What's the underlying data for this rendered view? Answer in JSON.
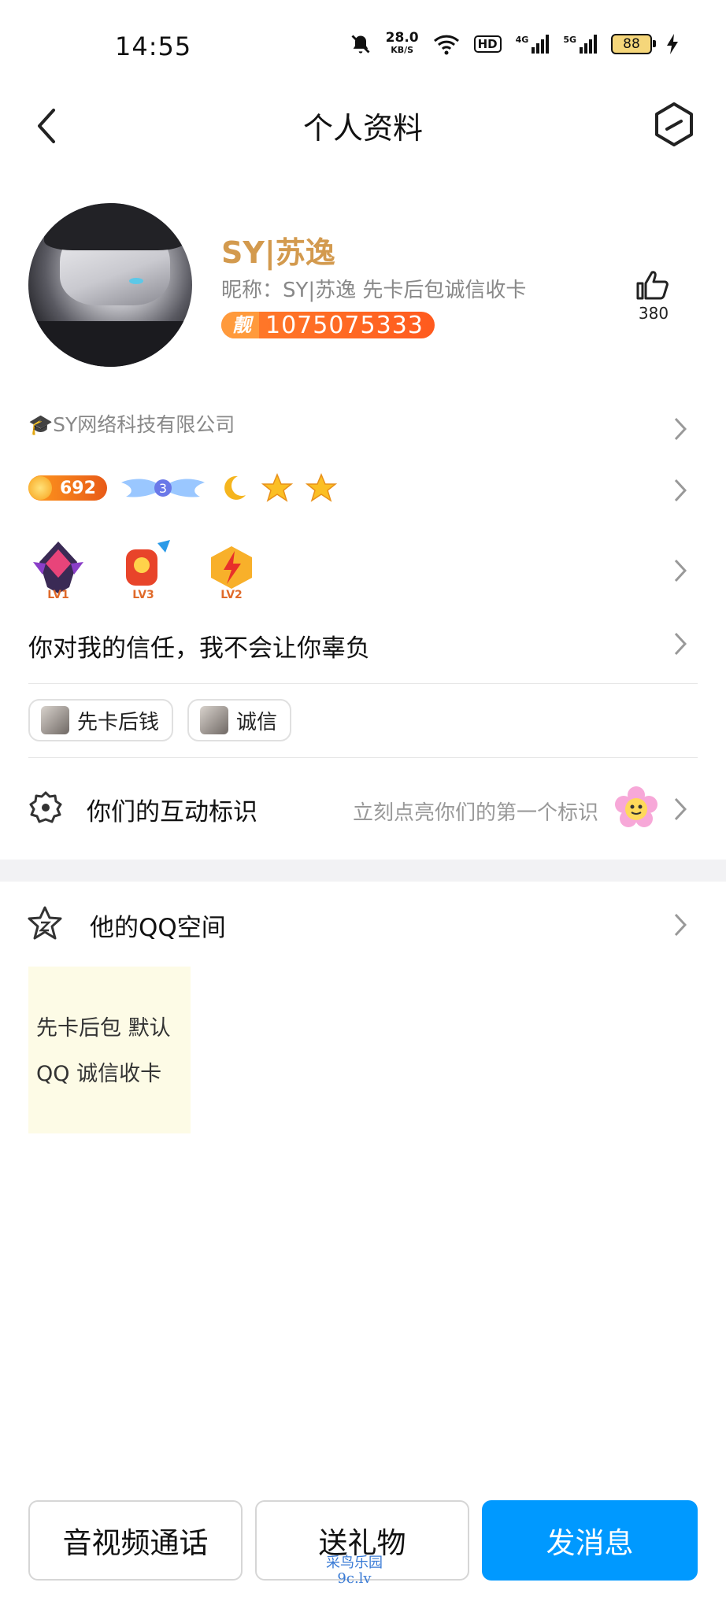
{
  "status_bar": {
    "time": "14:55",
    "net_speed": "28.0",
    "net_unit": "KB/S",
    "hd": "HD",
    "sig1": "4G",
    "sig2": "5G",
    "battery": "88"
  },
  "header": {
    "title": "个人资料"
  },
  "profile": {
    "display_name": "SY|苏逸",
    "nickname_line": "昵称：SY|苏逸 先卡后包诚信收卡",
    "badge_label": "靓",
    "qq_number": "1075075333",
    "likes": "380"
  },
  "company": "🎓SY网络科技有限公司",
  "levels": {
    "coin_value": "692",
    "wing_level": "3"
  },
  "badges": [
    {
      "label": "LV1"
    },
    {
      "label": "LV3"
    },
    {
      "label": "LV2"
    }
  ],
  "signature": "你对我的信任，我不会让你辜负",
  "tags": [
    {
      "label": "先卡后钱"
    },
    {
      "label": "诚信"
    }
  ],
  "interaction": {
    "label": "你们的互动标识",
    "hint": "立刻点亮你们的第一个标识"
  },
  "qzone": {
    "label": "他的QQ空间",
    "line1": "先卡后包 默认",
    "line2": "QQ 诚信收卡"
  },
  "actions": {
    "call": "音视频通话",
    "gift": "送礼物",
    "message": "发消息"
  },
  "watermark": {
    "line1": "采鸟乐园",
    "line2": "9c.lv"
  },
  "colors": {
    "primary": "#0099ff",
    "name": "#d39a4e",
    "badge": "#ff6a1e"
  }
}
